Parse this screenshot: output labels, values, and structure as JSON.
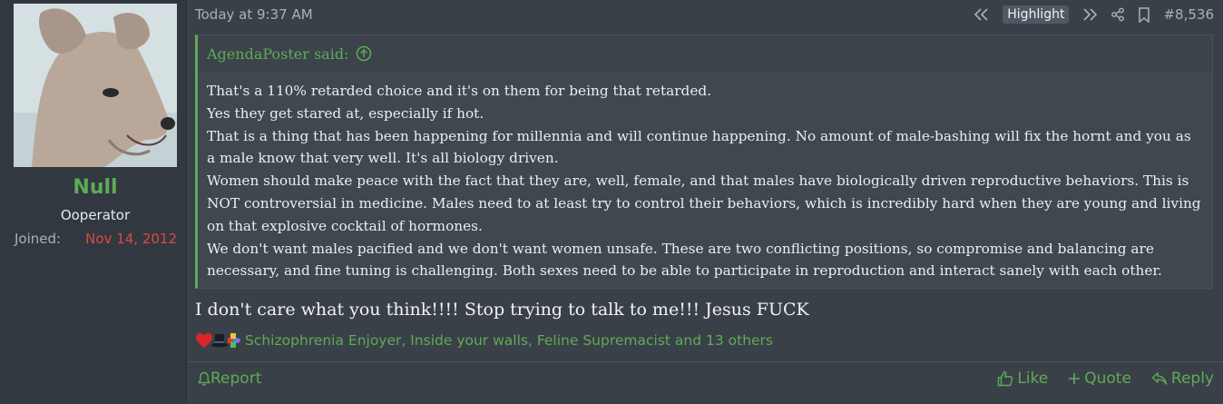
{
  "user": {
    "name": "Null",
    "title": "Ooperator",
    "joined_label": "Joined:",
    "joined_value": "Nov 14, 2012",
    "avatar_icon": "dog-avatar-icon"
  },
  "header": {
    "timestamp": "Today at 9:37 AM",
    "highlight_label": "Highlight",
    "post_number": "#8,536"
  },
  "quote": {
    "author_line": "AgendaPoster said:",
    "lines": [
      "That's a 110% retarded choice and it's on them for being that retarded.",
      "Yes they get stared at, especially if hot.",
      "That is a thing that has been happening for millennia and will continue happening. No amount of male-bashing will fix the hornt and you as a male know that very well. It's all biology driven.",
      "Women should make peace with the fact that they are, well, female, and that males have biologically driven reproductive behaviors. This is NOT controversial in medicine. Males need to at least try to control their behaviors, which is incredibly hard when they are young and living on that explosive cocktail of hormones.",
      "We don't want males pacified and we don't want women unsafe. These are two conflicting positions, so compromise and balancing are necessary, and fine tuning is challenging. Both sexes need to be able to participate in reproduction and interact sanely with each other."
    ]
  },
  "message": "I don't care what you think!!!! Stop trying to talk to me!!! Jesus FUCK",
  "reactions": {
    "text": "Schizophrenia Enjoyer, Inside your walls, Feline Supremacist and 13 others",
    "icons": [
      "heart-icon",
      "top-hat-icon",
      "puzzle-piece-icon"
    ]
  },
  "footer": {
    "report": "Report",
    "like": "Like",
    "quote": "Quote",
    "reply": "Reply"
  },
  "colors": {
    "accent": "#5eab56",
    "joined_date": "#d94b43",
    "background": "#3a4048"
  }
}
